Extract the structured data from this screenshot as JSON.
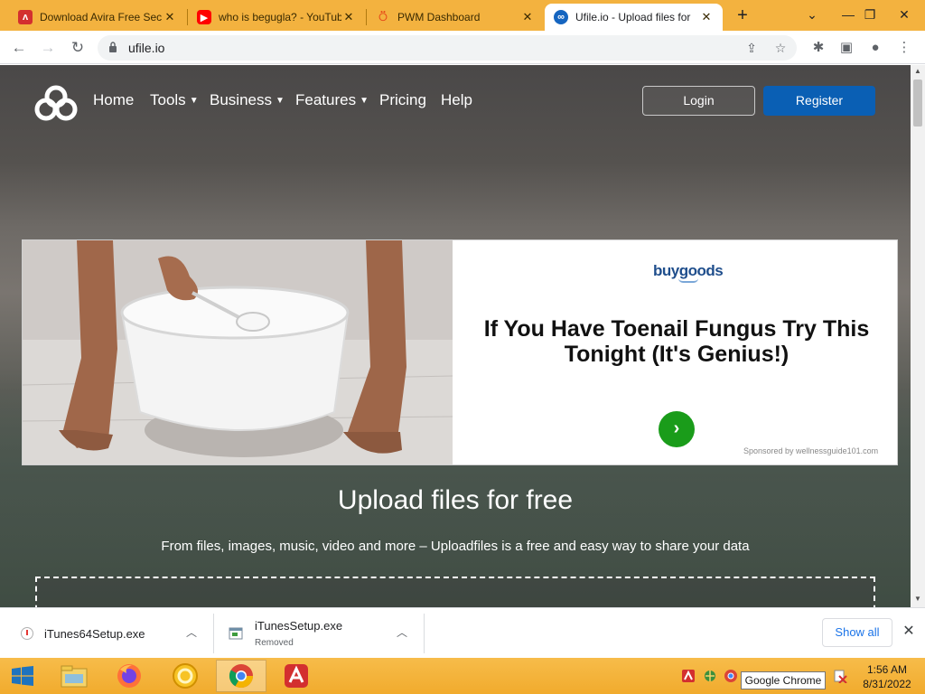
{
  "browser": {
    "tabs": [
      {
        "title": "Download Avira Free Sec",
        "icon": "avira-icon",
        "color": "#d32f2f"
      },
      {
        "title": "who is begugla? - YouTub",
        "icon": "youtube-icon",
        "color": "#ff0000"
      },
      {
        "title": "PWM Dashboard",
        "icon": "pwm-icon",
        "color": "#e64a19"
      },
      {
        "title": "Ufile.io - Upload files for",
        "icon": "ufile-icon",
        "color": "#1565c0"
      }
    ],
    "active_tab": 3,
    "url": "ufile.io"
  },
  "page": {
    "nav": {
      "home": "Home",
      "tools": "Tools",
      "business": "Business",
      "features": "Features",
      "pricing": "Pricing",
      "help": "Help"
    },
    "login": "Login",
    "register": "Register",
    "ad": {
      "brand": "buygoods",
      "headline": "If You Have Toenail Fungus Try This Tonight (It's Genius!)",
      "sponsor": "Sponsored by wellnessguide101.com"
    },
    "hero_title": "Upload files for free",
    "hero_subtitle": "From files, images, music, video and more – Uploadfiles is a free and easy way to share your data"
  },
  "downloads": {
    "items": [
      {
        "name": "iTunes64Setup.exe",
        "status": ""
      },
      {
        "name": "iTunesSetup.exe",
        "status": "Removed"
      }
    ],
    "show_all": "Show all"
  },
  "taskbar": {
    "time": "1:56 AM",
    "date": "8/31/2022",
    "tooltip": "Google Chrome"
  },
  "colors": {
    "tabstrip": "#f3b23f",
    "register_button": "#0a5fb4",
    "ad_go_button": "#1a9c1a"
  }
}
